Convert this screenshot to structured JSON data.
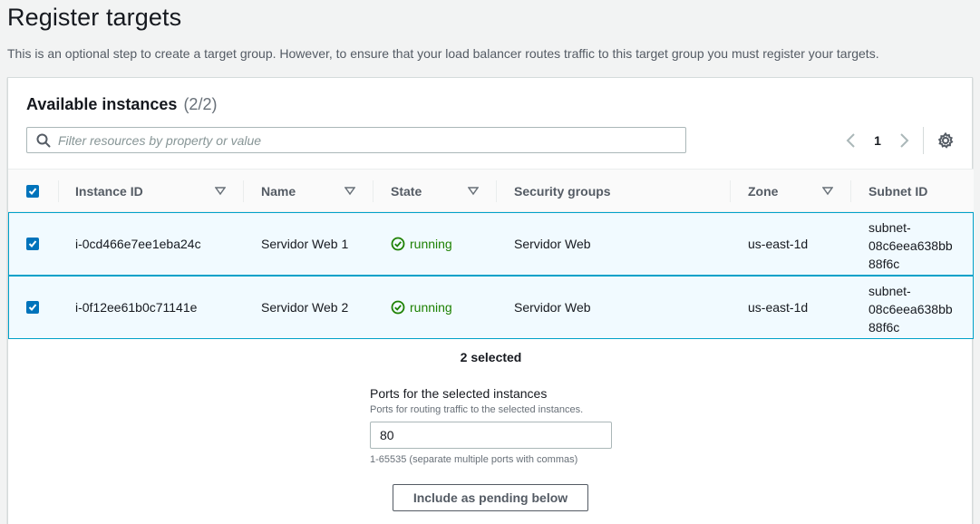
{
  "page": {
    "title": "Register targets",
    "description": "This is an optional step to create a target group. However, to ensure that your load balancer routes traffic to this target group you must register your targets."
  },
  "panel": {
    "title": "Available instances",
    "count": "(2/2)",
    "filter_placeholder": "Filter resources by property or value",
    "current_page": "1"
  },
  "table": {
    "columns": [
      "Instance ID",
      "Name",
      "State",
      "Security groups",
      "Zone",
      "Subnet ID"
    ],
    "rows": [
      {
        "instance_id": "i-0cd466e7ee1eba24c",
        "name": "Servidor Web 1",
        "state": "running",
        "security_groups": "Servidor Web",
        "zone": "us-east-1d",
        "subnet": [
          "subnet-",
          "08c6eea638bb",
          "88f6c"
        ]
      },
      {
        "instance_id": "i-0f12ee61b0c71141e",
        "name": "Servidor Web 2",
        "state": "running",
        "security_groups": "Servidor Web",
        "zone": "us-east-1d",
        "subnet": [
          "subnet-",
          "08c6eea638bb",
          "88f6c"
        ]
      }
    ]
  },
  "selection": {
    "selected_text": "2 selected"
  },
  "ports": {
    "label": "Ports for the selected instances",
    "description": "Ports for routing traffic to the selected instances.",
    "value": "80",
    "hint": "1-65535 (separate multiple ports with commas)"
  },
  "include_button": "Include as pending below",
  "colors": {
    "accent": "#0073bb",
    "running": "#1d8102",
    "row_selected_bg": "#f1faff",
    "row_selected_border": "#00a1c9"
  },
  "icons": [
    "search-icon",
    "chevron-left-icon",
    "chevron-right-icon",
    "gear-icon",
    "sort-icon",
    "check-icon",
    "status-ok-icon"
  ]
}
